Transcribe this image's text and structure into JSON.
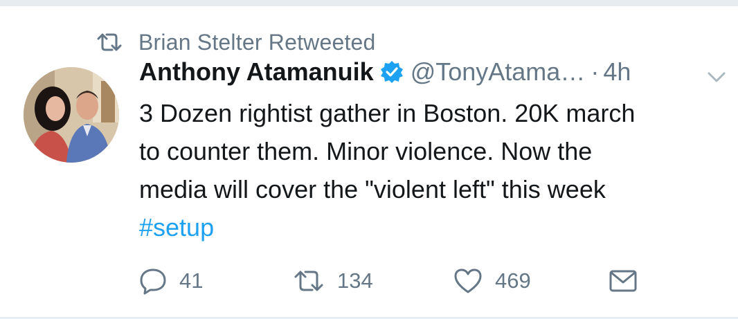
{
  "retweet_context": {
    "icon": "retweet-icon",
    "text": "Brian Stelter Retweeted"
  },
  "author": {
    "display_name": "Anthony Atamanuik",
    "verified": true,
    "handle": "@TonyAtama…",
    "separator": "·",
    "time": "4h"
  },
  "tweet": {
    "lines": [
      "3 Dozen rightist gather in Boston. 20K march",
      "to counter them. Minor violence.  Now the",
      "media will cover the \"violent left\" this week"
    ],
    "hashtag": "#setup"
  },
  "actions": {
    "reply": {
      "icon": "reply-icon",
      "count": "41"
    },
    "retweet": {
      "icon": "retweet-icon",
      "count": "134"
    },
    "like": {
      "icon": "heart-icon",
      "count": "469"
    },
    "dm": {
      "icon": "mail-icon"
    }
  },
  "colors": {
    "text": "#14171a",
    "secondary": "#657786",
    "accent": "#1da1f2",
    "divider": "#e6ecf0"
  }
}
